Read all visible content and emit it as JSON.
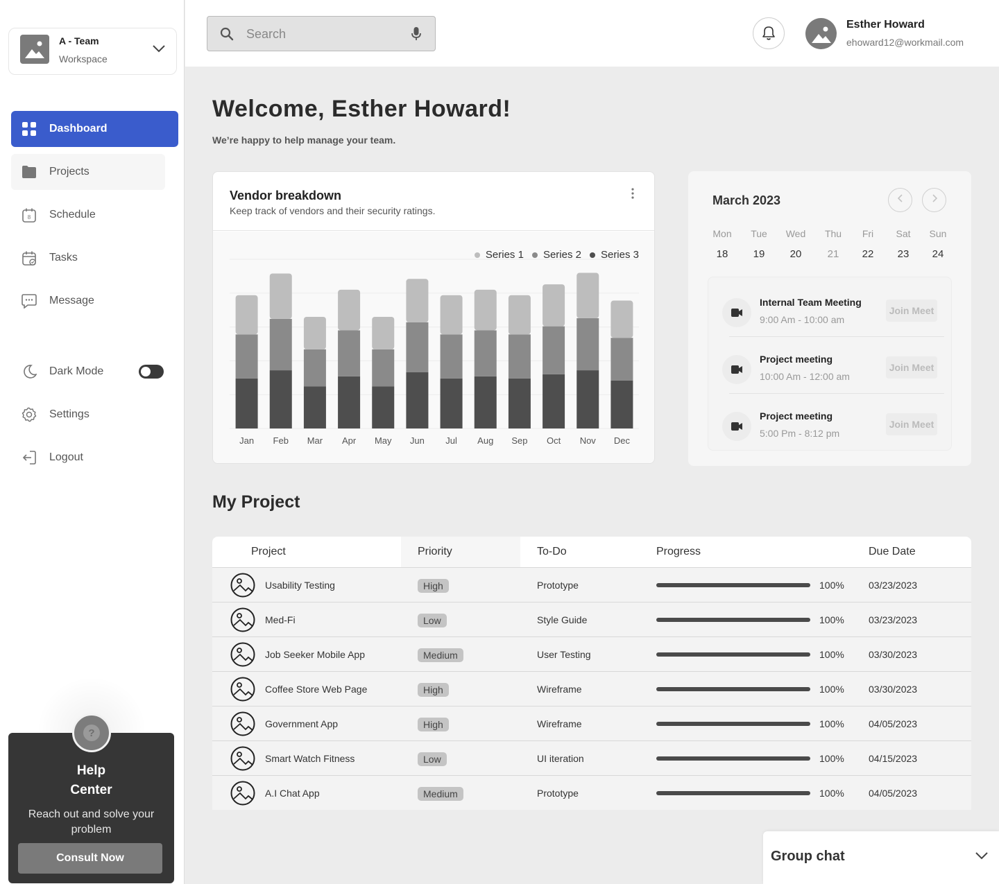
{
  "workspace": {
    "name": "A - Team",
    "label": "Workspace"
  },
  "nav": {
    "dashboard": "Dashboard",
    "projects": "Projects",
    "schedule": "Schedule",
    "tasks": "Tasks",
    "message": "Message",
    "dark_mode": "Dark Mode",
    "settings": "Settings",
    "logout": "Logout"
  },
  "dark_mode_on": false,
  "help": {
    "title_line1": "Help",
    "title_line2": "Center",
    "text": "Reach out and solve your problem",
    "button": "Consult Now"
  },
  "search": {
    "placeholder": "Search"
  },
  "user": {
    "name": "Esther Howard",
    "email": "ehoward12@workmail.com"
  },
  "welcome": {
    "title": "Welcome, Esther Howard!",
    "subtitle": "We’re happy to help manage your team."
  },
  "vendor": {
    "title": "Vendor breakdown",
    "subtitle": "Keep track of vendors and their security ratings."
  },
  "chart_data": {
    "type": "bar",
    "stacked": true,
    "categories": [
      "Jan",
      "Feb",
      "Mar",
      "Apr",
      "May",
      "Jun",
      "Jul",
      "Aug",
      "Sep",
      "Oct",
      "Nov",
      "Dec"
    ],
    "series": [
      {
        "name": "Series 1",
        "color": "#bdbdbd",
        "values": [
          58,
          67,
          48,
          60,
          48,
          64,
          58,
          60,
          58,
          62,
          67,
          55
        ]
      },
      {
        "name": "Series 2",
        "color": "#8a8a8a",
        "values": [
          65,
          76,
          55,
          68,
          55,
          74,
          65,
          68,
          65,
          71,
          77,
          63
        ]
      },
      {
        "name": "Series 3",
        "color": "#4e4e4e",
        "values": [
          74,
          86,
          62,
          77,
          62,
          83,
          74,
          77,
          74,
          80,
          86,
          71
        ]
      }
    ],
    "ylim": [
      0,
      250
    ],
    "grid": true,
    "legend": "top-right"
  },
  "calendar": {
    "title": "March 2023",
    "days_of_week": [
      "Mon",
      "Tue",
      "Wed",
      "Thu",
      "Fri",
      "Sat",
      "Sun"
    ],
    "dates": [
      "18",
      "19",
      "20",
      "21",
      "22",
      "23",
      "24"
    ],
    "dimmed_index": 3,
    "meetings": [
      {
        "title": "Internal Team Meeting",
        "time": "9:00  Am - 10:00 am",
        "button": "Join Meet"
      },
      {
        "title": "Project meeting",
        "time": "10:00 Am - 12:00 am",
        "button": "Join Meet"
      },
      {
        "title": "Project meeting",
        "time": "5:00 Pm - 8:12 pm",
        "button": "Join Meet"
      }
    ]
  },
  "projects": {
    "title": "My Project",
    "columns": [
      "Project",
      "Priority",
      "To-Do",
      "Progress",
      "Due Date"
    ],
    "rows": [
      {
        "name": "Usability Testing",
        "priority": "High",
        "todo": "Prototype",
        "progress": "100%",
        "progress_value": 1.0,
        "due": "03/23/2023"
      },
      {
        "name": "Med-Fi",
        "priority": "Low",
        "todo": "Style Guide",
        "progress": "100%",
        "progress_value": 1.0,
        "due": "03/23/2023"
      },
      {
        "name": "Job Seeker Mobile App",
        "priority": "Medium",
        "todo": "User Testing",
        "progress": "100%",
        "progress_value": 1.0,
        "due": "03/30/2023"
      },
      {
        "name": "Coffee Store Web Page",
        "priority": "High",
        "todo": "Wireframe",
        "progress": "100%",
        "progress_value": 1.0,
        "due": "03/30/2023"
      },
      {
        "name": "Government App",
        "priority": "High",
        "todo": "Wireframe",
        "progress": "100%",
        "progress_value": 1.0,
        "due": "04/05/2023"
      },
      {
        "name": "Smart Watch Fitness",
        "priority": "Low",
        "todo": "UI iteration",
        "progress": "100%",
        "progress_value": 1.0,
        "due": "04/15/2023"
      },
      {
        "name": "A.I Chat App",
        "priority": "Medium",
        "todo": "Prototype",
        "progress": "100%",
        "progress_value": 1.0,
        "due": "04/05/2023"
      }
    ]
  },
  "group_chat": {
    "label": "Group chat"
  }
}
